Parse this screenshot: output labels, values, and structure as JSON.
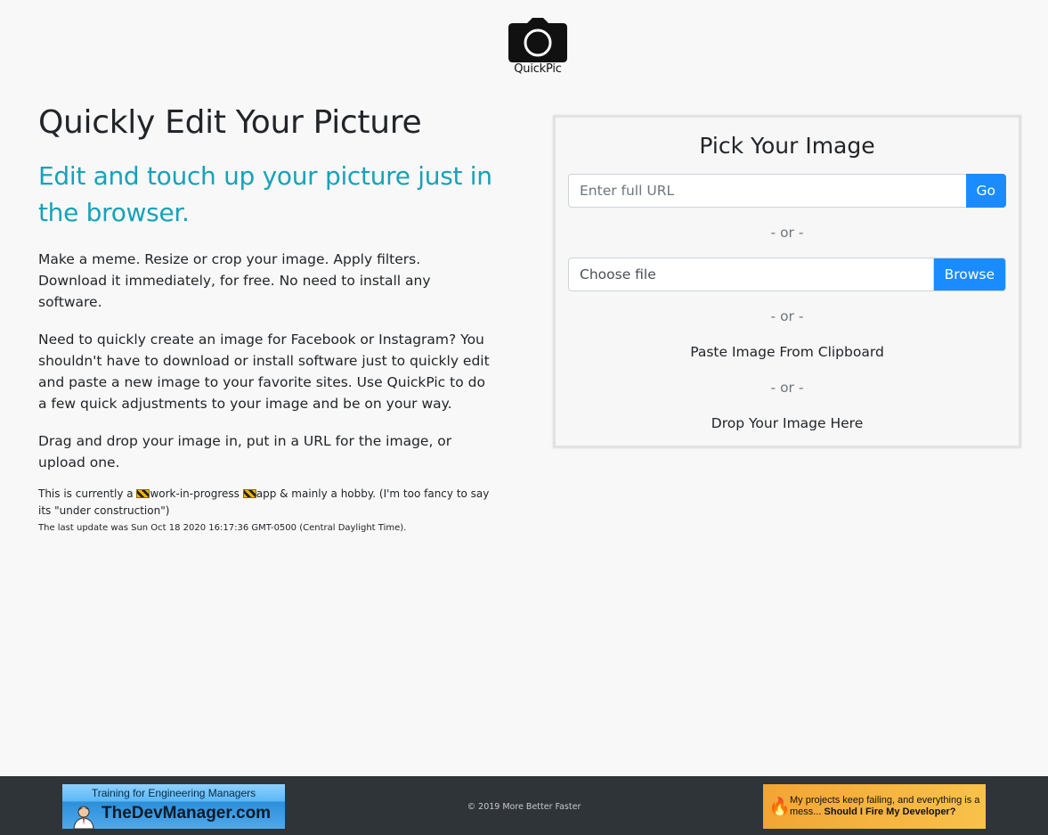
{
  "header": {
    "logo_text": "QuickPic",
    "logo_icon": "camera-icon"
  },
  "intro": {
    "title": "Quickly Edit Your Picture",
    "subtitle": "Edit and touch up your picture just in the browser.",
    "paragraph1": "Make a meme. Resize or crop your image. Apply filters. Download it immediately, for free. No need to install any software.",
    "paragraph2": "Need to quickly create an image for Facebook or Instagram? You shouldn't have to download or install software just to quickly edit and paste a new image to your favorite sites. Use QuickPic to do a few quick adjustments to your image and be on your way.",
    "paragraph3": "Drag and drop your image in, put in a URL for the image, or upload one.",
    "note_part1": "This is currently a ",
    "note_part2": "work-in-progress ",
    "note_part3": "app & mainly a hobby. (I'm too fancy to say its \"under construction\")",
    "last_update": "The last update was Sun Oct 18 2020 16:17:36 GMT-0500 (Central Daylight Time)."
  },
  "picker": {
    "title": "Pick Your Image",
    "url_placeholder": "Enter full URL",
    "go_label": "Go",
    "or_text": "- or -",
    "file_label": "Choose file",
    "browse_label": "Browse",
    "paste_label": "Paste Image From Clipboard",
    "drop_label": "Drop Your Image Here"
  },
  "footer": {
    "left_ad_top": "Training for Engineering Managers",
    "left_ad_main": "TheDevManager.com",
    "copyright": "© 2019 More Better Faster",
    "right_ad_text_1": "My projects keep failing, and everything is a mess... ",
    "right_ad_text_2": "Should I Fire My Developer?"
  },
  "colors": {
    "accent_teal": "#17a2b8",
    "primary_button": "#1a8cff",
    "footer_bg": "#2f3438",
    "page_bg": "#f8f8f8"
  }
}
